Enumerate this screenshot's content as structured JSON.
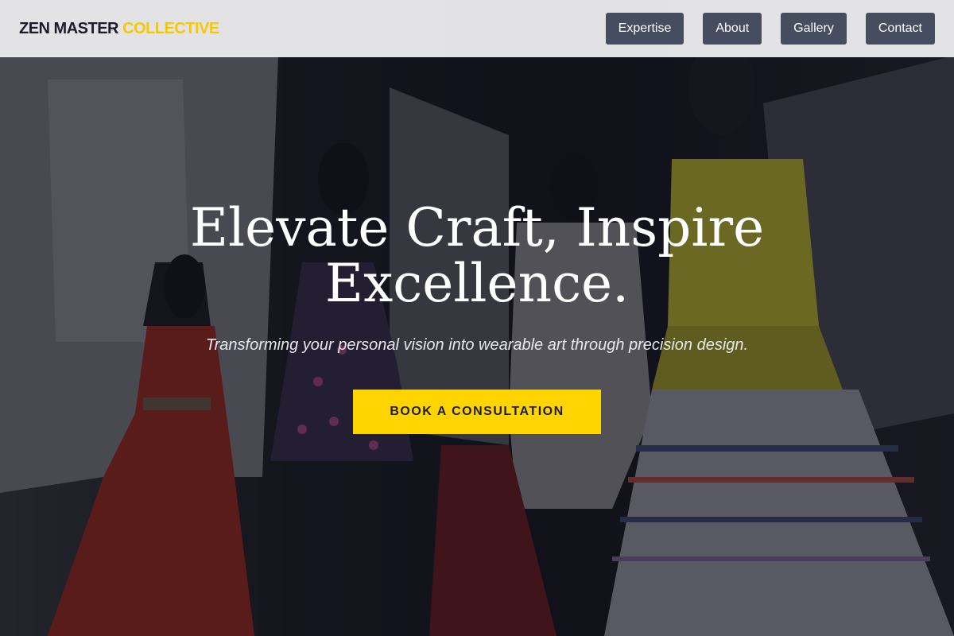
{
  "brand": {
    "part1": "ZEN MASTER",
    "part2": "COLLECTIVE"
  },
  "nav": {
    "items": [
      "Expertise",
      "About",
      "Gallery",
      "Contact"
    ]
  },
  "hero": {
    "headline_line1": "Elevate Craft, Inspire",
    "headline_line2": "Excellence.",
    "tagline": "Transforming your personal vision into wearable art through precision design.",
    "cta_label": "BOOK A CONSULTATION",
    "background": "fashion exhibition photo with mannequins in gowns"
  },
  "colors": {
    "accent": "#ffd400",
    "nav_button": "#454d5e",
    "navbar_bg": "#eeeef0",
    "brand_dark": "#1b1b2a"
  }
}
